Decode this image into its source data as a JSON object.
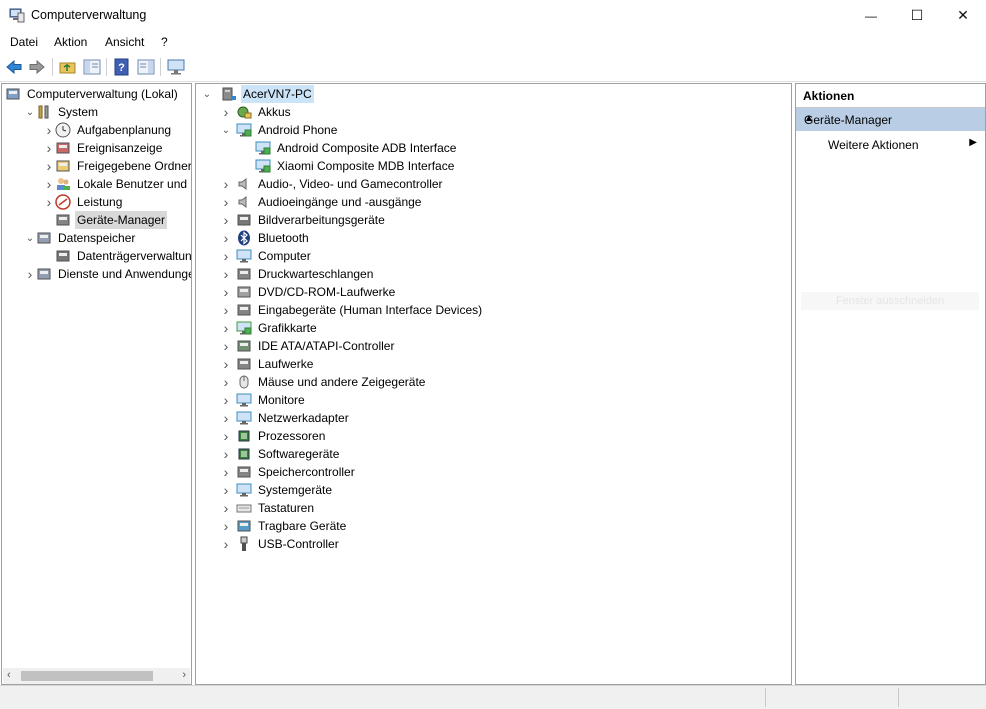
{
  "window": {
    "title": "Computerverwaltung",
    "minimize": "—",
    "maximize": "☐",
    "close": "✕"
  },
  "menu": {
    "items": [
      "Datei",
      "Aktion",
      "Ansicht",
      "?"
    ]
  },
  "toolbar": {
    "icons": [
      "back-arrow-icon",
      "forward-arrow-icon",
      "up-folder-icon",
      "show-hide-tree-icon",
      "help-icon",
      "properties-icon",
      "monitor-icon"
    ]
  },
  "left_tree": {
    "items": [
      {
        "label": "Computerverwaltung (Lokal)",
        "level": 0,
        "expand": "",
        "icon": "computer-management-icon"
      },
      {
        "label": "System",
        "level": 1,
        "expand": "v",
        "icon": "tools-icon"
      },
      {
        "label": "Aufgabenplanung",
        "level": 2,
        "expand": ">",
        "icon": "clock-icon"
      },
      {
        "label": "Ereignisanzeige",
        "level": 2,
        "expand": ">",
        "icon": "event-viewer-icon"
      },
      {
        "label": "Freigegebene Ordner",
        "level": 2,
        "expand": ">",
        "icon": "shared-folder-icon"
      },
      {
        "label": "Lokale Benutzer und Gruppen",
        "level": 2,
        "expand": ">",
        "icon": "users-icon"
      },
      {
        "label": "Leistung",
        "level": 2,
        "expand": ">",
        "icon": "performance-icon"
      },
      {
        "label": "Geräte-Manager",
        "level": 2,
        "expand": "",
        "icon": "device-manager-icon",
        "selected": true
      },
      {
        "label": "Datenspeicher",
        "level": 1,
        "expand": "v",
        "icon": "storage-icon"
      },
      {
        "label": "Datenträgerverwaltung",
        "level": 2,
        "expand": "",
        "icon": "disk-management-icon"
      },
      {
        "label": "Dienste und Anwendungen",
        "level": 1,
        "expand": ">",
        "icon": "services-icon"
      }
    ]
  },
  "device_tree": {
    "root": "AcerVN7-PC",
    "items": [
      {
        "label": "Akkus",
        "level": 1,
        "expand": ">",
        "icon": "battery-icon"
      },
      {
        "label": "Android Phone",
        "level": 1,
        "expand": "v",
        "icon": "phone-icon"
      },
      {
        "label": "Android Composite ADB Interface",
        "level": 2,
        "expand": "",
        "icon": "adb-device-icon"
      },
      {
        "label": "Xiaomi Composite MDB Interface",
        "level": 2,
        "expand": "",
        "icon": "mdb-device-icon"
      },
      {
        "label": "Audio-, Video- und Gamecontroller",
        "level": 1,
        "expand": ">",
        "icon": "speaker-icon"
      },
      {
        "label": "Audioeingänge und -ausgänge",
        "level": 1,
        "expand": ">",
        "icon": "audio-io-icon"
      },
      {
        "label": "Bildverarbeitungsgeräte",
        "level": 1,
        "expand": ">",
        "icon": "camera-icon"
      },
      {
        "label": "Bluetooth",
        "level": 1,
        "expand": ">",
        "icon": "bluetooth-icon"
      },
      {
        "label": "Computer",
        "level": 1,
        "expand": ">",
        "icon": "computer-icon"
      },
      {
        "label": "Druckwarteschlangen",
        "level": 1,
        "expand": ">",
        "icon": "printer-icon"
      },
      {
        "label": "DVD/CD-ROM-Laufwerke",
        "level": 1,
        "expand": ">",
        "icon": "dvd-icon"
      },
      {
        "label": "Eingabegeräte (Human Interface Devices)",
        "level": 1,
        "expand": ">",
        "icon": "hid-icon"
      },
      {
        "label": "Grafikkarte",
        "level": 1,
        "expand": ">",
        "icon": "display-adapter-icon"
      },
      {
        "label": "IDE ATA/ATAPI-Controller",
        "level": 1,
        "expand": ">",
        "icon": "ide-controller-icon"
      },
      {
        "label": "Laufwerke",
        "level": 1,
        "expand": ">",
        "icon": "drive-icon"
      },
      {
        "label": "Mäuse und andere Zeigegeräte",
        "level": 1,
        "expand": ">",
        "icon": "mouse-icon"
      },
      {
        "label": "Monitore",
        "level": 1,
        "expand": ">",
        "icon": "monitor-icon"
      },
      {
        "label": "Netzwerkadapter",
        "level": 1,
        "expand": ">",
        "icon": "network-adapter-icon"
      },
      {
        "label": "Prozessoren",
        "level": 1,
        "expand": ">",
        "icon": "processor-icon"
      },
      {
        "label": "Softwaregeräte",
        "level": 1,
        "expand": ">",
        "icon": "software-device-icon"
      },
      {
        "label": "Speichercontroller",
        "level": 1,
        "expand": ">",
        "icon": "storage-controller-icon"
      },
      {
        "label": "Systemgeräte",
        "level": 1,
        "expand": ">",
        "icon": "system-device-icon"
      },
      {
        "label": "Tastaturen",
        "level": 1,
        "expand": ">",
        "icon": "keyboard-icon"
      },
      {
        "label": "Tragbare Geräte",
        "level": 1,
        "expand": ">",
        "icon": "portable-device-icon"
      },
      {
        "label": "USB-Controller",
        "level": 1,
        "expand": ">",
        "icon": "usb-icon"
      }
    ]
  },
  "actions": {
    "header": "Aktionen",
    "section": "Geräte-Manager",
    "item": "Weitere Aktionen",
    "ghost_item": "Fenster ausschneiden"
  },
  "colors": {
    "selection": "#d9d9d9",
    "action_section": "#b9cde5",
    "accent_blue": "#1e73be"
  }
}
